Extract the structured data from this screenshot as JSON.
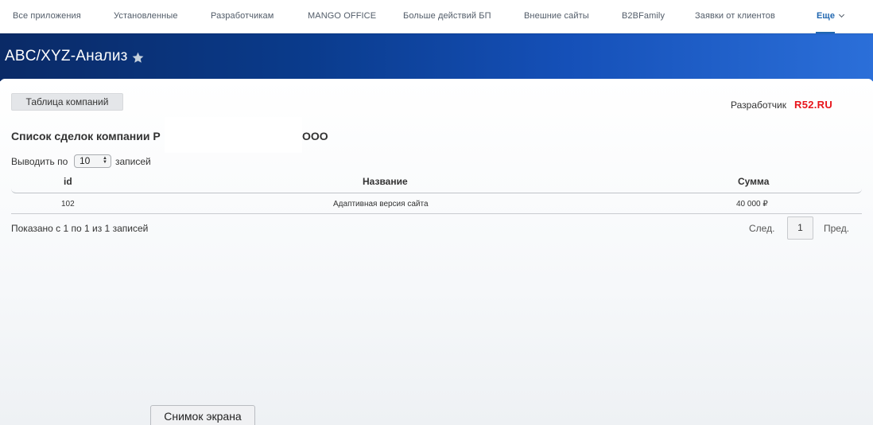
{
  "topnav": {
    "items": [
      "Все приложения",
      "Установленные",
      "Разработчикам",
      "MANGO OFFICE",
      "Больше действий БП",
      "Внешние сайты",
      "B2BFamily",
      "Заявки от клиентов"
    ],
    "more_label": "Еще"
  },
  "header": {
    "title": "ABC/XYZ-Анализ"
  },
  "toolbar": {
    "companies_button": "Таблица компаний",
    "developer_label": "Разработчик",
    "developer_brand": "R52.RU",
    "developer_brand_color": "#e8141a"
  },
  "list": {
    "title_prefix": "Список сделок компании Р",
    "title_suffix": "ООО",
    "page_size_label": "Выводить по",
    "page_size_value": "10",
    "page_size_suffix": "записей",
    "columns": [
      "id",
      "Название",
      "Сумма"
    ],
    "rows": [
      {
        "id": "102",
        "name": "Адаптивная версия сайта",
        "amount": "40 000 ₽"
      }
    ],
    "info": "Показано с 1 по 1 из 1 записей",
    "pagination": {
      "next": "След.",
      "current": "1",
      "prev": "Пред."
    }
  },
  "footer": {
    "screenshot_button": "Снимок экрана"
  },
  "colors": {
    "accent": "#2067b0",
    "banner_start": "#0a2a66",
    "banner_end": "#2b6fd9"
  }
}
